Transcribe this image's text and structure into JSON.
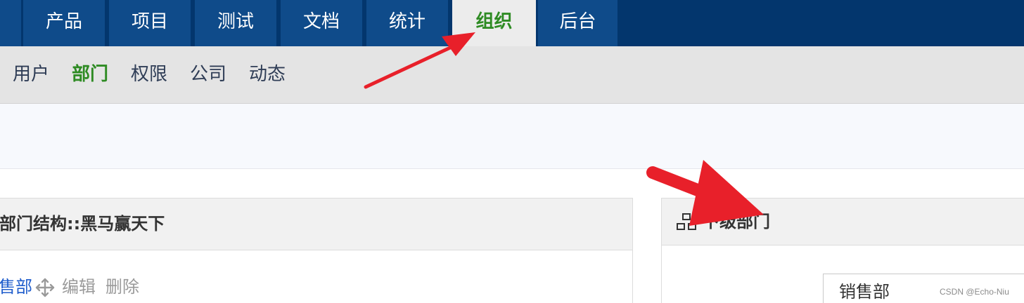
{
  "top_nav": {
    "tabs": [
      {
        "label": "产品"
      },
      {
        "label": "项目"
      },
      {
        "label": "测试"
      },
      {
        "label": "文档"
      },
      {
        "label": "统计"
      },
      {
        "label": "组织",
        "active": true
      },
      {
        "label": "后台"
      }
    ]
  },
  "sub_nav": {
    "items": [
      {
        "label": "用户"
      },
      {
        "label": "部门",
        "active": true
      },
      {
        "label": "权限"
      },
      {
        "label": "公司"
      },
      {
        "label": "动态"
      }
    ]
  },
  "left_panel": {
    "title": "部门结构::黑马赢天下",
    "dept_name": "售部",
    "move_icon": "move-arrows-icon",
    "edit_label": "编辑",
    "delete_label": "删除"
  },
  "right_panel": {
    "icon": "sitemap-icon",
    "title": "下级部门",
    "child_value": "销售部"
  },
  "watermark": "CSDN @Echo-Niu",
  "colors": {
    "nav_bg": "#03366d",
    "tab_bg": "#0f4b8a",
    "active_green": "#2e8b23",
    "annotation_red": "#e8202a"
  }
}
